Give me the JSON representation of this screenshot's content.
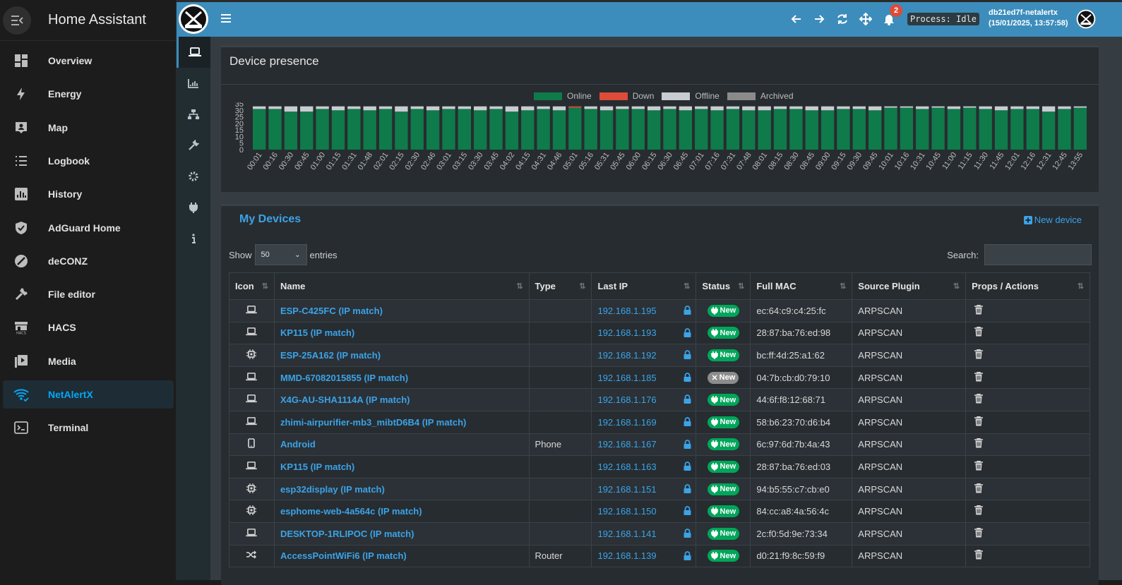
{
  "ha": {
    "title": "Home Assistant",
    "nav": [
      {
        "label": "Overview",
        "icon": "overview-icon"
      },
      {
        "label": "Energy",
        "icon": "energy-icon"
      },
      {
        "label": "Map",
        "icon": "map-icon"
      },
      {
        "label": "Logbook",
        "icon": "logbook-icon"
      },
      {
        "label": "History",
        "icon": "history-icon"
      },
      {
        "label": "AdGuard Home",
        "icon": "shield-icon"
      },
      {
        "label": "deCONZ",
        "icon": "deconz-icon"
      },
      {
        "label": "File editor",
        "icon": "wrench-icon"
      },
      {
        "label": "HACS",
        "icon": "hacs-icon"
      },
      {
        "label": "Media",
        "icon": "media-icon"
      },
      {
        "label": "NetAlertX",
        "icon": "wifi-icon",
        "active": true
      },
      {
        "label": "Terminal",
        "icon": "terminal-icon"
      }
    ]
  },
  "topbar": {
    "notif_count": "2",
    "process": "Process: Idle",
    "host": "db21ed7f-netalertx",
    "timestamp": "(15/01/2025, 13:57:58)"
  },
  "presence": {
    "title": "Device presence",
    "legend": [
      "Online",
      "Down",
      "Offline",
      "Archived"
    ],
    "colors": {
      "online": "#0f7a4a",
      "down": "#dd4b39",
      "offline": "#c9ccd0",
      "archived": "#8a8a8a"
    }
  },
  "chart_data": {
    "type": "bar",
    "stacked": true,
    "ylim": [
      0,
      35
    ],
    "yticks": [
      "35",
      "30",
      "25",
      "20",
      "15",
      "10",
      "5",
      "0"
    ],
    "categories": [
      "00:01",
      "00:16",
      "00:30",
      "00:45",
      "01:00",
      "01:15",
      "01:31",
      "01:48",
      "02:01",
      "02:15",
      "02:30",
      "02:46",
      "03:01",
      "03:15",
      "03:30",
      "03:45",
      "04:02",
      "04:15",
      "04:31",
      "04:46",
      "05:01",
      "05:16",
      "05:31",
      "05:45",
      "06:00",
      "06:15",
      "06:30",
      "06:45",
      "07:01",
      "07:16",
      "07:31",
      "07:48",
      "08:01",
      "08:15",
      "08:30",
      "08:45",
      "09:00",
      "09:15",
      "09:30",
      "09:45",
      "10:01",
      "10:16",
      "10:31",
      "10:45",
      "11:00",
      "11:15",
      "11:30",
      "11:45",
      "12:01",
      "12:16",
      "12:31",
      "12:45",
      "13:55"
    ],
    "series": [
      {
        "name": "Online",
        "values": [
          31,
          31,
          29,
          29,
          31,
          30,
          31,
          30,
          31,
          29,
          31,
          30,
          31,
          31,
          30,
          31,
          29,
          30,
          31,
          30,
          32,
          31,
          30,
          31,
          31,
          30,
          31,
          30,
          31,
          30,
          31,
          30,
          30,
          31,
          31,
          30,
          30,
          31,
          31,
          30,
          32,
          32,
          31,
          32,
          31,
          32,
          31,
          30,
          31,
          31,
          29,
          31,
          32
        ]
      },
      {
        "name": "Down",
        "values": [
          0,
          0,
          0,
          0,
          0,
          0,
          0,
          0,
          0,
          0,
          0,
          0,
          0,
          0,
          0,
          0,
          0,
          0,
          0,
          0,
          1,
          0,
          0,
          0,
          0,
          0,
          0,
          0,
          0,
          0,
          0,
          0,
          0,
          0,
          0,
          0,
          0,
          0,
          0,
          0,
          0,
          0,
          0,
          0,
          0,
          0,
          0,
          0,
          0,
          0,
          0,
          0,
          0
        ]
      },
      {
        "name": "Offline",
        "values": [
          2,
          2,
          4,
          4,
          2,
          3,
          2,
          3,
          2,
          4,
          2,
          3,
          2,
          2,
          3,
          2,
          4,
          3,
          2,
          3,
          0,
          2,
          3,
          2,
          2,
          3,
          2,
          3,
          2,
          3,
          2,
          3,
          3,
          2,
          2,
          3,
          3,
          2,
          2,
          3,
          1,
          1,
          2,
          1,
          2,
          1,
          2,
          3,
          2,
          2,
          4,
          2,
          1
        ]
      }
    ]
  },
  "devices": {
    "title": "My Devices",
    "new_device": "New device",
    "show_label": "Show",
    "entries_value": "50",
    "entries_label": "entries",
    "search_label": "Search:",
    "columns": [
      "Icon",
      "Name",
      "Type",
      "Last IP",
      "Status",
      "Full MAC",
      "Source Plugin",
      "Props / Actions"
    ],
    "rows": [
      {
        "icon": "laptop-icon",
        "name": "ESP-C425FC (IP match)",
        "type": "",
        "ip": "192.168.1.195",
        "status": "New",
        "online": true,
        "mac": "ec:64:c9:c4:25:fc",
        "plugin": "ARPSCAN"
      },
      {
        "icon": "laptop-icon",
        "name": "KP115 (IP match)",
        "type": "",
        "ip": "192.168.1.193",
        "status": "New",
        "online": true,
        "mac": "28:87:ba:76:ed:98",
        "plugin": "ARPSCAN"
      },
      {
        "icon": "chip-icon",
        "name": "ESP-25A162 (IP match)",
        "type": "",
        "ip": "192.168.1.192",
        "status": "New",
        "online": true,
        "mac": "bc:ff:4d:25:a1:62",
        "plugin": "ARPSCAN"
      },
      {
        "icon": "laptop-icon",
        "name": "MMD-67082015855 (IP match)",
        "type": "",
        "ip": "192.168.1.185",
        "status": "New",
        "online": false,
        "mac": "04:7b:cb:d0:79:10",
        "plugin": "ARPSCAN"
      },
      {
        "icon": "laptop-icon",
        "name": "X4G-AU-SHA1114A (IP match)",
        "type": "",
        "ip": "192.168.1.176",
        "status": "New",
        "online": true,
        "mac": "44:6f:f8:12:68:71",
        "plugin": "ARPSCAN"
      },
      {
        "icon": "laptop-icon",
        "name": "zhimi-airpurifier-mb3_mibtD6B4 (IP match)",
        "type": "",
        "ip": "192.168.1.169",
        "status": "New",
        "online": true,
        "mac": "58:b6:23:70:d6:b4",
        "plugin": "ARPSCAN"
      },
      {
        "icon": "phone-icon",
        "name": "Android",
        "type": "Phone",
        "ip": "192.168.1.167",
        "status": "New",
        "online": true,
        "mac": "6c:97:6d:7b:4a:43",
        "plugin": "ARPSCAN"
      },
      {
        "icon": "laptop-icon",
        "name": "KP115 (IP match)",
        "type": "",
        "ip": "192.168.1.163",
        "status": "New",
        "online": true,
        "mac": "28:87:ba:76:ed:03",
        "plugin": "ARPSCAN"
      },
      {
        "icon": "chip-icon",
        "name": "esp32display (IP match)",
        "type": "",
        "ip": "192.168.1.151",
        "status": "New",
        "online": true,
        "mac": "94:b5:55:c7:cb:e0",
        "plugin": "ARPSCAN"
      },
      {
        "icon": "chip-icon",
        "name": "esphome-web-4a564c (IP match)",
        "type": "",
        "ip": "192.168.1.150",
        "status": "New",
        "online": true,
        "mac": "84:cc:a8:4a:56:4c",
        "plugin": "ARPSCAN"
      },
      {
        "icon": "laptop-icon",
        "name": "DESKTOP-1RLIPOC (IP match)",
        "type": "",
        "ip": "192.168.1.141",
        "status": "New",
        "online": true,
        "mac": "2c:f0:5d:9e:73:34",
        "plugin": "ARPSCAN"
      },
      {
        "icon": "shuffle-icon",
        "name": "AccessPointWiFi6 (IP match)",
        "type": "Router",
        "ip": "192.168.1.139",
        "status": "New",
        "online": true,
        "mac": "d0:21:f9:8c:59:f9",
        "plugin": "ARPSCAN"
      }
    ]
  }
}
